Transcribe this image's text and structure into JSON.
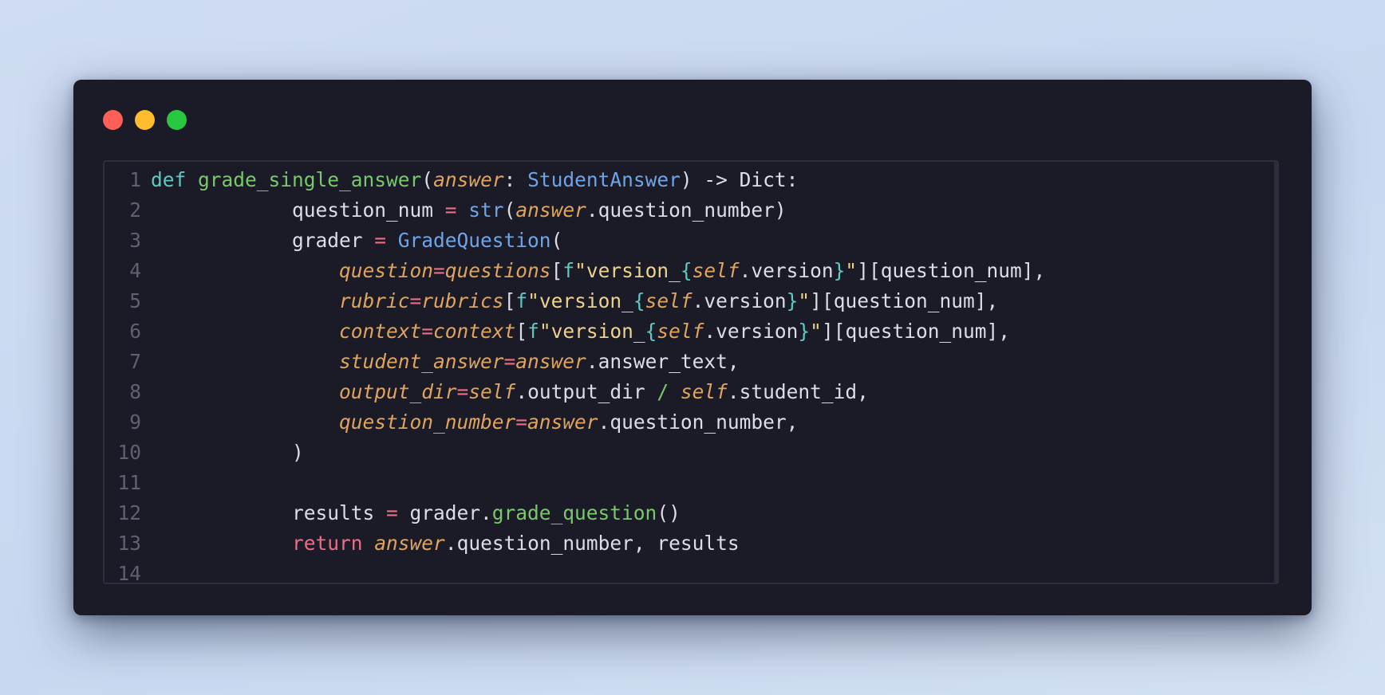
{
  "window": {
    "traffic_lights": [
      {
        "name": "close",
        "color": "#fe5f57"
      },
      {
        "name": "minimize",
        "color": "#febc2e"
      },
      {
        "name": "maximize",
        "color": "#28c840"
      }
    ]
  },
  "code": {
    "language": "python",
    "lines": [
      {
        "n": "1",
        "tokens": [
          {
            "t": "def",
            "k": "kw"
          },
          {
            "t": " ",
            "k": "pl"
          },
          {
            "t": "grade_single_answer",
            "k": "fn"
          },
          {
            "t": "(",
            "k": "pl"
          },
          {
            "t": "answer",
            "k": "prm"
          },
          {
            "t": ": ",
            "k": "pl"
          },
          {
            "t": "StudentAnswer",
            "k": "typ"
          },
          {
            "t": ") -> Dict:",
            "k": "pl"
          }
        ]
      },
      {
        "n": "2",
        "tokens": [
          {
            "t": "            question_num ",
            "k": "pl"
          },
          {
            "t": "=",
            "k": "op"
          },
          {
            "t": " ",
            "k": "pl"
          },
          {
            "t": "str",
            "k": "bi"
          },
          {
            "t": "(",
            "k": "pl"
          },
          {
            "t": "answer",
            "k": "prm"
          },
          {
            "t": ".question_number)",
            "k": "pl"
          }
        ]
      },
      {
        "n": "3",
        "tokens": [
          {
            "t": "            grader ",
            "k": "pl"
          },
          {
            "t": "=",
            "k": "op"
          },
          {
            "t": " ",
            "k": "pl"
          },
          {
            "t": "GradeQuestion",
            "k": "typ"
          },
          {
            "t": "(",
            "k": "pl"
          }
        ]
      },
      {
        "n": "4",
        "tokens": [
          {
            "t": "                ",
            "k": "pl"
          },
          {
            "t": "question",
            "k": "prm"
          },
          {
            "t": "=",
            "k": "op"
          },
          {
            "t": "questions",
            "k": "prm"
          },
          {
            "t": "[",
            "k": "pl"
          },
          {
            "t": "f",
            "k": "kw"
          },
          {
            "t": "\"version_",
            "k": "str"
          },
          {
            "t": "{",
            "k": "br"
          },
          {
            "t": "self",
            "k": "prm"
          },
          {
            "t": ".version",
            "k": "pl"
          },
          {
            "t": "}",
            "k": "br"
          },
          {
            "t": "\"",
            "k": "str"
          },
          {
            "t": "][question_num],",
            "k": "pl"
          }
        ]
      },
      {
        "n": "5",
        "tokens": [
          {
            "t": "                ",
            "k": "pl"
          },
          {
            "t": "rubric",
            "k": "prm"
          },
          {
            "t": "=",
            "k": "op"
          },
          {
            "t": "rubrics",
            "k": "prm"
          },
          {
            "t": "[",
            "k": "pl"
          },
          {
            "t": "f",
            "k": "kw"
          },
          {
            "t": "\"version_",
            "k": "str"
          },
          {
            "t": "{",
            "k": "br"
          },
          {
            "t": "self",
            "k": "prm"
          },
          {
            "t": ".version",
            "k": "pl"
          },
          {
            "t": "}",
            "k": "br"
          },
          {
            "t": "\"",
            "k": "str"
          },
          {
            "t": "][question_num],",
            "k": "pl"
          }
        ]
      },
      {
        "n": "6",
        "tokens": [
          {
            "t": "                ",
            "k": "pl"
          },
          {
            "t": "context",
            "k": "prm"
          },
          {
            "t": "=",
            "k": "op"
          },
          {
            "t": "context",
            "k": "prm"
          },
          {
            "t": "[",
            "k": "pl"
          },
          {
            "t": "f",
            "k": "kw"
          },
          {
            "t": "\"version_",
            "k": "str"
          },
          {
            "t": "{",
            "k": "br"
          },
          {
            "t": "self",
            "k": "prm"
          },
          {
            "t": ".version",
            "k": "pl"
          },
          {
            "t": "}",
            "k": "br"
          },
          {
            "t": "\"",
            "k": "str"
          },
          {
            "t": "][question_num],",
            "k": "pl"
          }
        ]
      },
      {
        "n": "7",
        "tokens": [
          {
            "t": "                ",
            "k": "pl"
          },
          {
            "t": "student_answer",
            "k": "prm"
          },
          {
            "t": "=",
            "k": "op"
          },
          {
            "t": "answer",
            "k": "prm"
          },
          {
            "t": ".answer_text,",
            "k": "pl"
          }
        ]
      },
      {
        "n": "8",
        "tokens": [
          {
            "t": "                ",
            "k": "pl"
          },
          {
            "t": "output_dir",
            "k": "prm"
          },
          {
            "t": "=",
            "k": "op"
          },
          {
            "t": "self",
            "k": "prm"
          },
          {
            "t": ".output_dir ",
            "k": "pl"
          },
          {
            "t": "/",
            "k": "fn"
          },
          {
            "t": " ",
            "k": "pl"
          },
          {
            "t": "self",
            "k": "prm"
          },
          {
            "t": ".student_id,",
            "k": "pl"
          }
        ]
      },
      {
        "n": "9",
        "tokens": [
          {
            "t": "                ",
            "k": "pl"
          },
          {
            "t": "question_number",
            "k": "prm"
          },
          {
            "t": "=",
            "k": "op"
          },
          {
            "t": "answer",
            "k": "prm"
          },
          {
            "t": ".question_number,",
            "k": "pl"
          }
        ]
      },
      {
        "n": "10",
        "tokens": [
          {
            "t": "            )",
            "k": "pl"
          }
        ]
      },
      {
        "n": "11",
        "tokens": []
      },
      {
        "n": "12",
        "tokens": [
          {
            "t": "            results ",
            "k": "pl"
          },
          {
            "t": "=",
            "k": "op"
          },
          {
            "t": " grader.",
            "k": "pl"
          },
          {
            "t": "grade_question",
            "k": "fn"
          },
          {
            "t": "()",
            "k": "pl"
          }
        ]
      },
      {
        "n": "13",
        "tokens": [
          {
            "t": "            ",
            "k": "pl"
          },
          {
            "t": "return",
            "k": "ret"
          },
          {
            "t": " ",
            "k": "pl"
          },
          {
            "t": "answer",
            "k": "prm"
          },
          {
            "t": ".question_number, results",
            "k": "pl"
          }
        ]
      },
      {
        "n": "14",
        "tokens": []
      }
    ]
  }
}
